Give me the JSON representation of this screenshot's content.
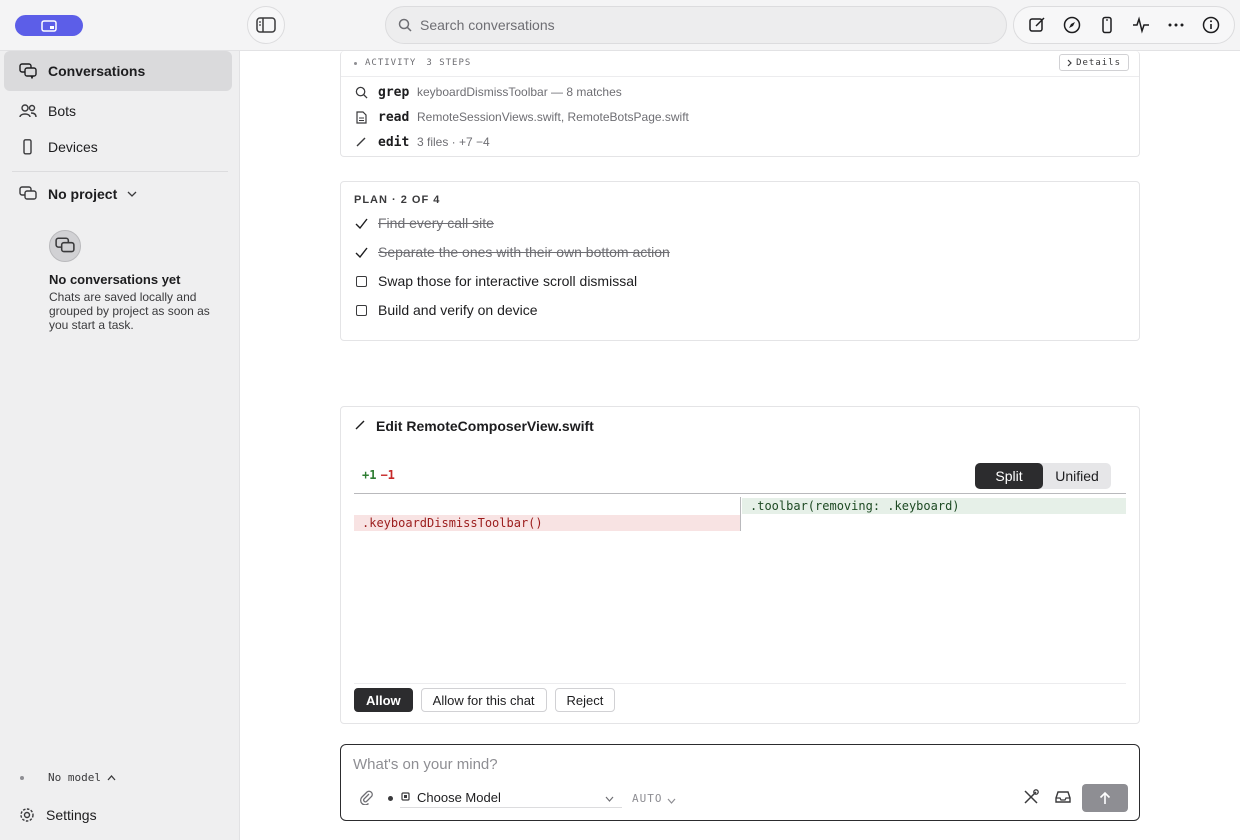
{
  "topbar": {
    "search_placeholder": "Search conversations"
  },
  "sidebar": {
    "items": [
      {
        "label": "Conversations",
        "icon": "chat-bubbles-icon",
        "active": true
      },
      {
        "label": "Bots",
        "icon": "people-icon",
        "active": false
      },
      {
        "label": "Devices",
        "icon": "phone-icon",
        "active": false
      }
    ],
    "project_label": "No project",
    "empty_title": "No conversations yet",
    "empty_desc": "Chats are saved locally and grouped by project as soon as you start a task.",
    "model_label": "No model",
    "settings_label": "Settings"
  },
  "activity": {
    "label": "ACTIVITY",
    "steps": "3 STEPS",
    "details_label": "Details",
    "rows": [
      {
        "cmd": "grep",
        "detail": "keyboardDismissToolbar — 8 matches",
        "icon": "search-icon"
      },
      {
        "cmd": "read",
        "detail": "RemoteSessionViews.swift, RemoteBotsPage.swift",
        "icon": "document-icon"
      },
      {
        "cmd": "edit",
        "detail": "3 files · +7 −4",
        "icon": "pencil-icon"
      }
    ]
  },
  "plan": {
    "header": "PLAN · 2 OF 4",
    "items": [
      {
        "text": "Find every call site",
        "done": true
      },
      {
        "text": "Separate the ones with their own bottom action",
        "done": true
      },
      {
        "text": "Swap those for interactive scroll dismissal",
        "done": false
      },
      {
        "text": "Build and verify on device",
        "done": false
      }
    ]
  },
  "edit": {
    "title": "Edit RemoteComposerView.swift",
    "added": "+1",
    "removed": "−1",
    "view_modes": [
      "Split",
      "Unified"
    ],
    "active_mode": "Split",
    "added_line": ".toolbar(removing: .keyboard)",
    "removed_line": ".keyboardDismissToolbar()",
    "actions": {
      "allow": "Allow",
      "allow_chat": "Allow for this chat",
      "reject": "Reject"
    }
  },
  "composer": {
    "placeholder": "What's on your mind?",
    "model_label": "Choose Model",
    "auto_label": "AUTO"
  }
}
